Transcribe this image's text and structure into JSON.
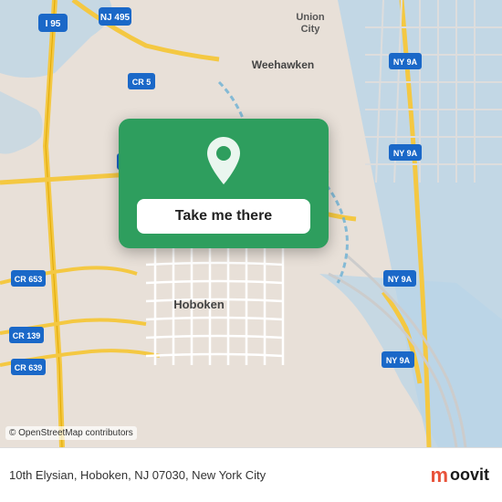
{
  "map": {
    "attribution": "© OpenStreetMap contributors",
    "location": "10th Elysian, Hoboken, NJ 07030, New York City"
  },
  "card": {
    "button_label": "Take me there"
  },
  "bottom_bar": {
    "address": "10th Elysian, Hoboken, NJ 07030, New York City",
    "logo_m": "m",
    "logo_text": "oovit"
  },
  "colors": {
    "green": "#2e9e5e",
    "moovit_red": "#e8523a"
  }
}
